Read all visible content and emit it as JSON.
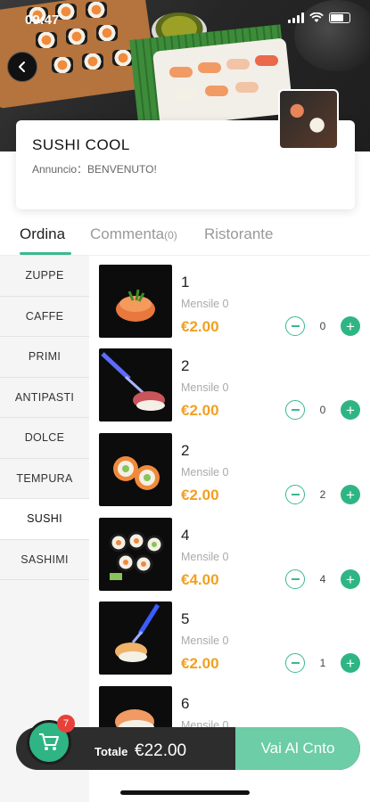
{
  "status_bar": {
    "time": "09:47"
  },
  "restaurant": {
    "name": "SUSHI COOL",
    "announcement": "Annuncio：BENVENUTO!"
  },
  "tabs": [
    {
      "label": "Ordina",
      "active": true
    },
    {
      "label": "Commenta",
      "count": "(0)",
      "active": false
    },
    {
      "label": "Ristorante",
      "active": false
    }
  ],
  "categories": [
    "ZUPPE",
    "CAFFE",
    "PRIMI",
    "ANTIPASTI",
    "DOLCE",
    "TEMPURA",
    "SUSHI",
    "SASHIMI"
  ],
  "active_category": "SUSHI",
  "items": [
    {
      "name": "1",
      "monthly": "Mensile 0",
      "price": "€2.00",
      "qty": "0"
    },
    {
      "name": "2",
      "monthly": "Mensile 0",
      "price": "€2.00",
      "qty": "0"
    },
    {
      "name": "2",
      "monthly": "Mensile 0",
      "price": "€2.00",
      "qty": "2"
    },
    {
      "name": "4",
      "monthly": "Mensile 0",
      "price": "€4.00",
      "qty": "4"
    },
    {
      "name": "5",
      "monthly": "Mensile 0",
      "price": "€2.00",
      "qty": "1"
    },
    {
      "name": "6",
      "monthly": "Mensile 0"
    }
  ],
  "cart": {
    "badge": "7",
    "total_label": "Totale",
    "total_value": "€22.00",
    "checkout_label": "Vai Al Cnto"
  },
  "colors": {
    "accent": "#3ab98c",
    "price": "#f0a023",
    "badge": "#e8413c",
    "bar": "#2d2d2d",
    "checkout": "#6ccda6"
  },
  "icons": [
    "back-arrow-icon",
    "cart-icon",
    "minus-icon",
    "plus-icon",
    "wifi-icon",
    "battery-icon",
    "signal-icon"
  ]
}
